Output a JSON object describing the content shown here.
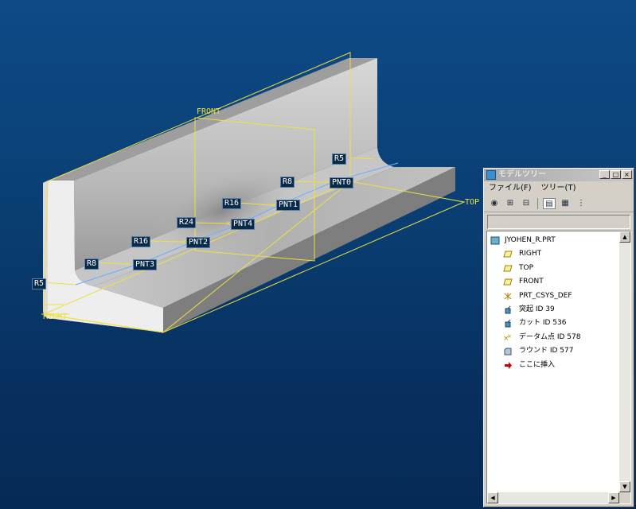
{
  "viewport": {
    "planes": [
      "FRONT",
      "TOP",
      "RIGHT"
    ],
    "points": [
      "PNT0",
      "PNT1",
      "PNT4",
      "PNT2",
      "PNT3"
    ],
    "radii": [
      "R5",
      "R8",
      "R16",
      "R24",
      "R16",
      "R8",
      "R5"
    ]
  },
  "tree_window": {
    "title": "モデルツリー",
    "buttons": {
      "minimize": "_",
      "maximize": "□",
      "close": "×"
    },
    "menu": [
      "ファイル(F)",
      "ツリー(T)"
    ],
    "items": [
      {
        "label": "JYOHEN_R.PRT",
        "icon": "part-icon"
      },
      {
        "label": "RIGHT",
        "icon": "datum-plane-icon"
      },
      {
        "label": "TOP",
        "icon": "datum-plane-icon"
      },
      {
        "label": "FRONT",
        "icon": "datum-plane-icon"
      },
      {
        "label": "PRT_CSYS_DEF",
        "icon": "csys-icon"
      },
      {
        "label": "突起 ID 39",
        "icon": "protrusion-icon"
      },
      {
        "label": "カット ID 536",
        "icon": "cut-icon"
      },
      {
        "label": "データム点 ID 578",
        "icon": "datum-point-icon"
      },
      {
        "label": "ラウンド ID 577",
        "icon": "round-icon"
      },
      {
        "label": "ここに挿入",
        "icon": "insert-arrow-icon"
      }
    ]
  },
  "colors": {
    "datum": "#f0e040",
    "background_top": "#0e4a86",
    "background_bottom": "#062a55",
    "insert_arrow": "#cc0000"
  }
}
